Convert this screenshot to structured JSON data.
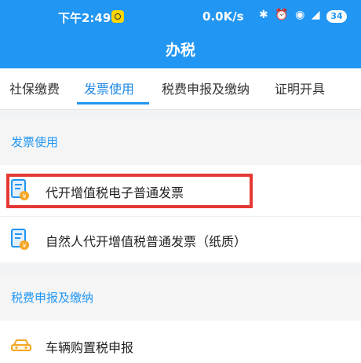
{
  "status_bar": {
    "time": "下午2:49",
    "speed": "0.0K/s",
    "icons": "✱ ⏰ ◉ ◢ ◢",
    "battery": "34"
  },
  "header": {
    "title": "办税"
  },
  "tabs": [
    {
      "label": "社保缴费"
    },
    {
      "label": "发票使用"
    },
    {
      "label": "税费申报及缴纳"
    },
    {
      "label": "证明开具"
    }
  ],
  "sections": {
    "invoice": {
      "title": "发票使用",
      "items": [
        {
          "label": "代开增值税电子普通发票"
        },
        {
          "label": "自然人代开增值税普通发票（纸质）"
        }
      ]
    },
    "tax": {
      "title": "税费申报及缴纳",
      "items": [
        {
          "label": "车辆购置税申报"
        }
      ]
    }
  },
  "colors": {
    "primary": "#2196f3",
    "highlight": "#e53935",
    "icon_orange": "#f5a623"
  }
}
